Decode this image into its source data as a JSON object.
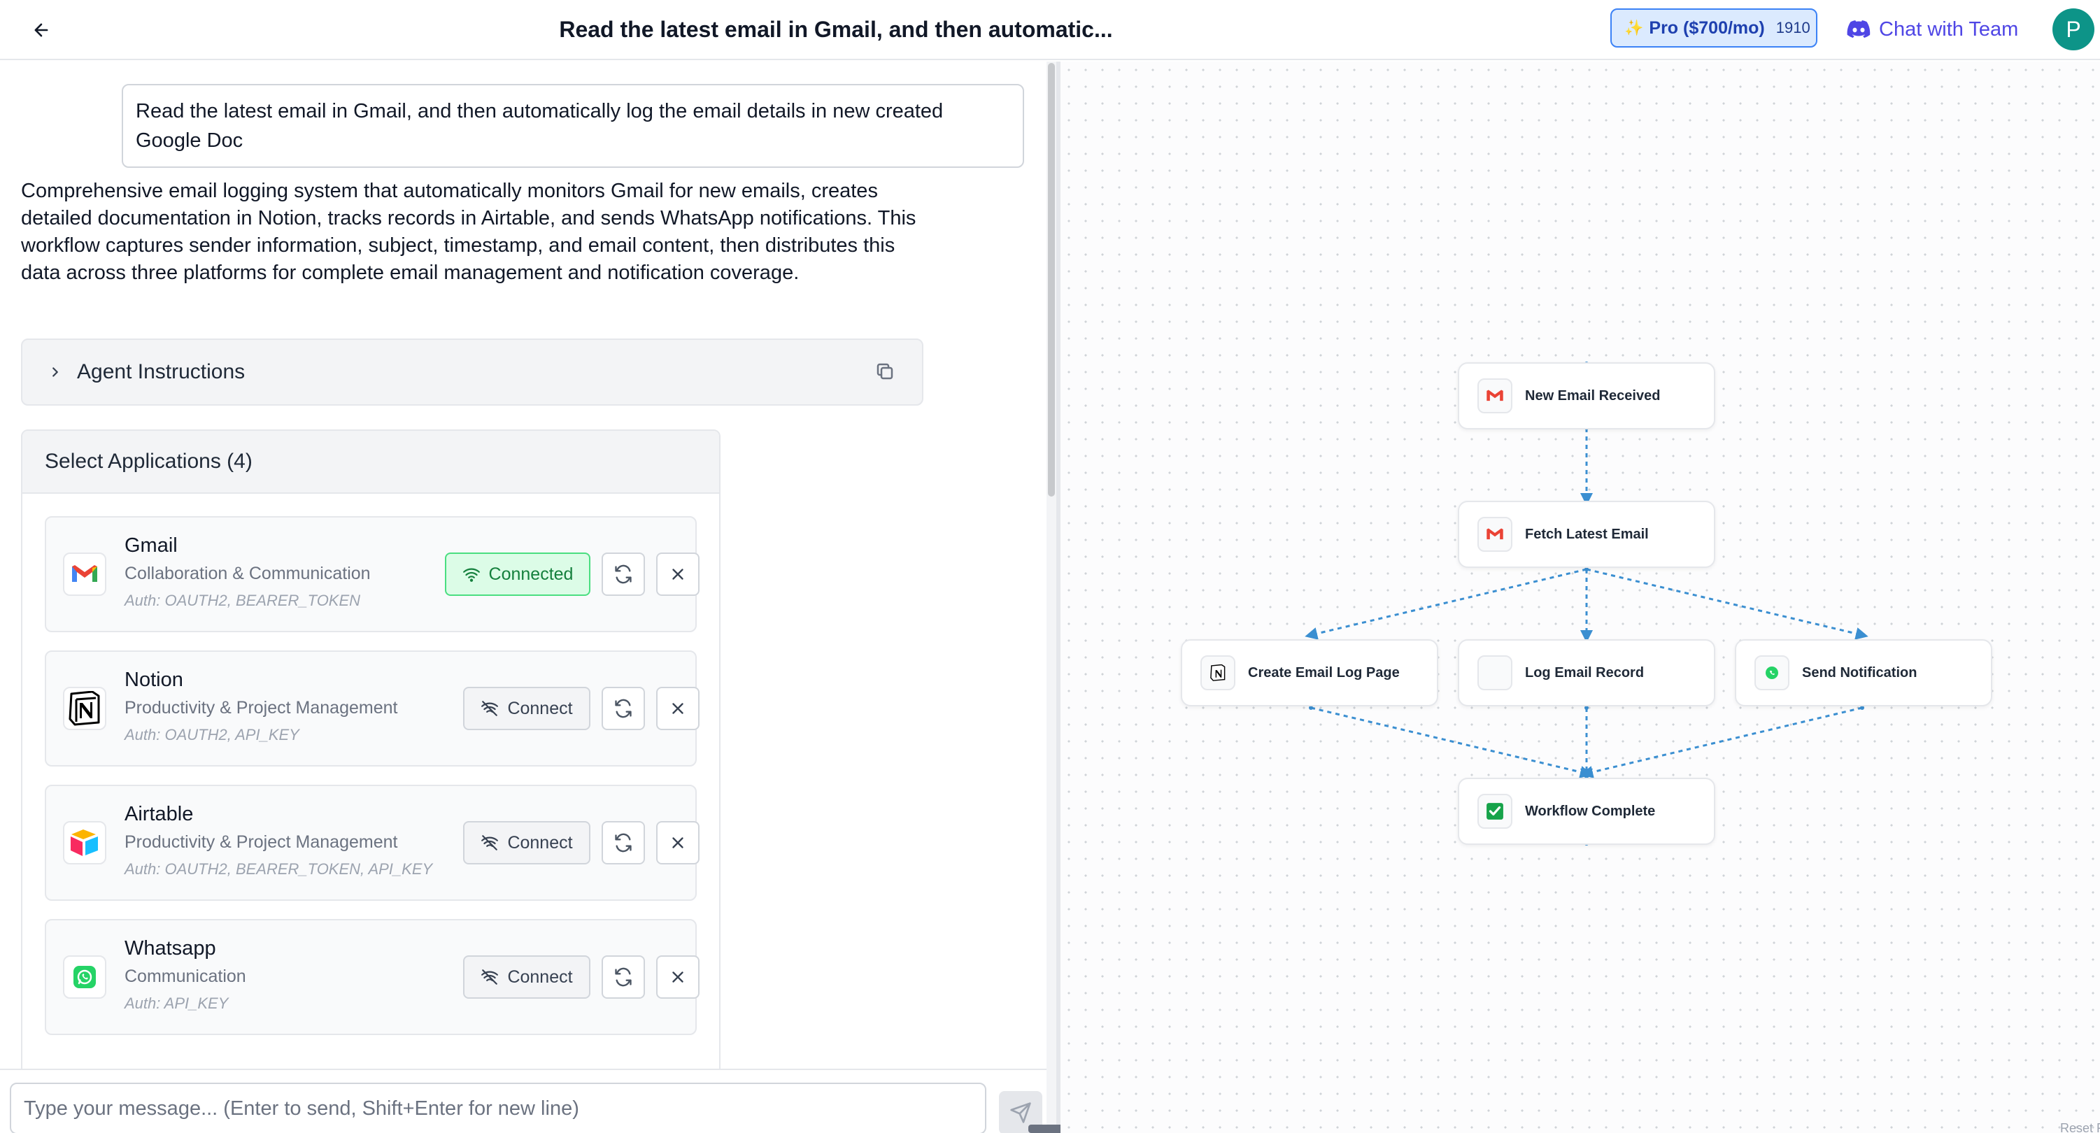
{
  "header": {
    "title": "Read the latest email in Gmail, and then automatic...",
    "pro_label": "Pro ($700/mo)",
    "pro_credits": "1910",
    "chat_team_label": "Chat with Team",
    "avatar_initial": "P"
  },
  "conversation": {
    "user_message": "Read the latest email in Gmail, and then automatically log the email details in new created Google Doc",
    "description": "Comprehensive email logging system that automatically monitors Gmail for new emails, creates detailed documentation in Notion, tracks records in Airtable, and sends WhatsApp notifications. This workflow captures sender information, subject, timestamp, and email content, then distributes this data across three platforms for complete email management and notification coverage."
  },
  "agent_instructions": {
    "label": "Agent Instructions"
  },
  "applications": {
    "header": "Select Applications (4)",
    "items": [
      {
        "name": "Gmail",
        "category": "Collaboration & Communication",
        "auth": "Auth: OAUTH2, BEARER_TOKEN",
        "status_label": "Connected",
        "icon": "gmail-logo"
      },
      {
        "name": "Notion",
        "category": "Productivity & Project Management",
        "auth": "Auth: OAUTH2, API_KEY",
        "status_label": "Connect",
        "icon": "notion-logo"
      },
      {
        "name": "Airtable",
        "category": "Productivity & Project Management",
        "auth": "Auth: OAUTH2, BEARER_TOKEN, API_KEY",
        "status_label": "Connect",
        "icon": "airtable-logo"
      },
      {
        "name": "Whatsapp",
        "category": "Communication",
        "auth": "Auth: API_KEY",
        "status_label": "Connect",
        "icon": "whatsapp-logo"
      }
    ]
  },
  "input": {
    "placeholder": "Type your message... (Enter to send, Shift+Enter for new line)"
  },
  "workflow": {
    "nodes": [
      {
        "label": "New Email Received",
        "icon": "gmail-icon"
      },
      {
        "label": "Fetch Latest Email",
        "icon": "gmail-icon"
      },
      {
        "label": "Create Email Log Page",
        "icon": "notion-icon"
      },
      {
        "label": "Log Email Record",
        "icon": "blank-icon"
      },
      {
        "label": "Send Notification",
        "icon": "whatsapp-icon"
      },
      {
        "label": "Workflow Complete",
        "icon": "check-icon"
      }
    ],
    "reset_label": "Reset Flo"
  },
  "colors": {
    "accent": "#4f46e5",
    "connected_green": "#15803d",
    "edge_blue": "#3b8fd1",
    "pro_blue": "#3b82f6"
  }
}
